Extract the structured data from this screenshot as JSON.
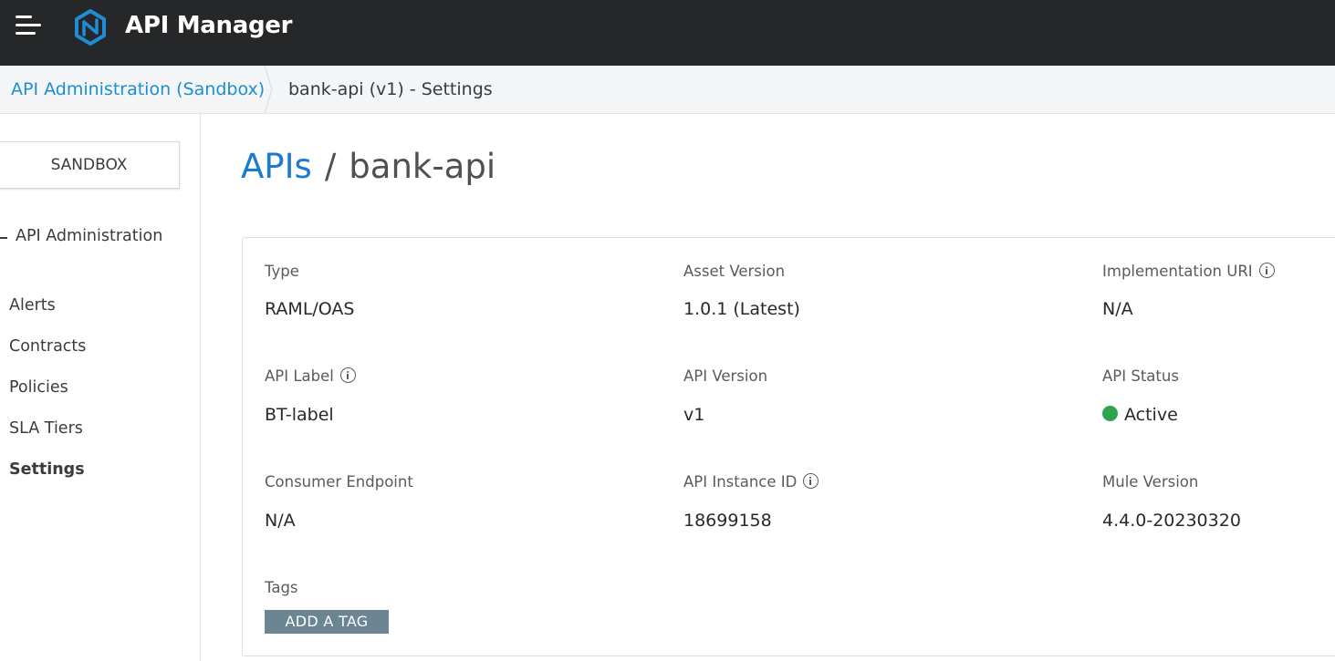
{
  "topbar": {
    "app_title": "API Manager",
    "menu_icon": "hamburger-menu-icon",
    "logo_icon": "api-manager-logo-icon",
    "background": "#262728"
  },
  "breadcrumb": {
    "parent": "API Administration (Sandbox)",
    "current": "bank-api (v1) - Settings"
  },
  "sidebar": {
    "environment": "SANDBOX",
    "section": "API Administration",
    "items": [
      {
        "label": "Alerts",
        "active": false
      },
      {
        "label": "Contracts",
        "active": false
      },
      {
        "label": "Policies",
        "active": false
      },
      {
        "label": "SLA Tiers",
        "active": false
      },
      {
        "label": "Settings",
        "active": true
      }
    ]
  },
  "page": {
    "root": "APIs",
    "separator": "/",
    "name": "bank-api"
  },
  "details": {
    "type_label": "Type",
    "type_value": "RAML/OAS",
    "asset_version_label": "Asset Version",
    "asset_version_value": "1.0.1 (Latest)",
    "implementation_uri_label": "Implementation URI",
    "implementation_uri_value": "N/A",
    "api_label_label": "API Label",
    "api_label_value": "BT-label",
    "api_version_label": "API Version",
    "api_version_value": "v1",
    "api_status_label": "API Status",
    "api_status_value": "Active",
    "consumer_endpoint_label": "Consumer Endpoint",
    "consumer_endpoint_value": "N/A",
    "api_instance_id_label": "API Instance ID",
    "api_instance_id_value": "18699158",
    "mule_version_label": "Mule Version",
    "mule_version_value": "4.4.0-20230320",
    "tags_label": "Tags",
    "add_tag_label": "ADD A TAG"
  },
  "colors": {
    "accent": "#1b8fd1",
    "status_active": "#2ea44f",
    "tag_button": "#6c8593"
  }
}
